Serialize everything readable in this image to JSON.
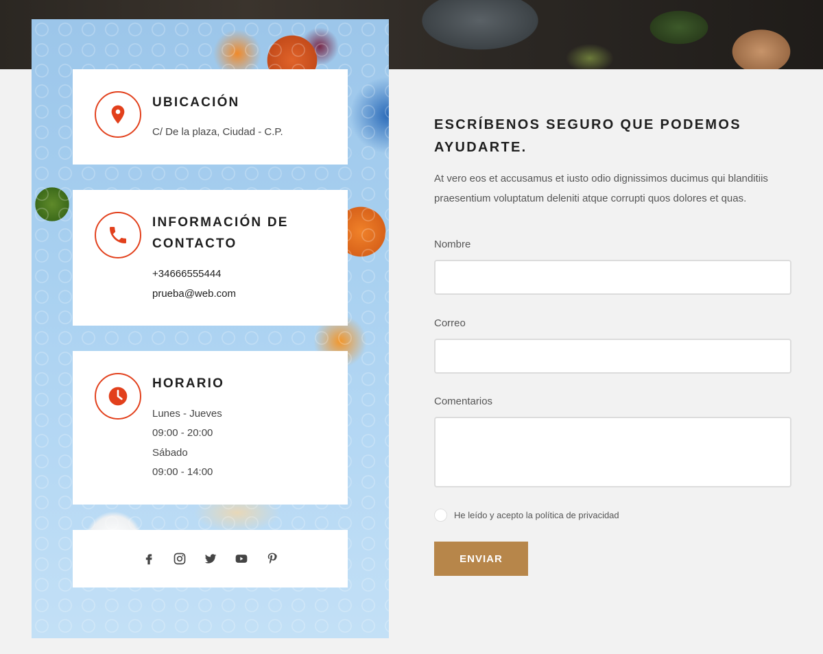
{
  "colors": {
    "accent": "#e2401c",
    "button": "#b7864a",
    "background": "#f2f2f2"
  },
  "contact": {
    "location": {
      "title": "UBICACIÓN",
      "address": "C/ De la plaza, Ciudad - C.P.",
      "icon": "map-pin-icon"
    },
    "info": {
      "title_line1": "INFORMACIÓN DE",
      "title_line2": "CONTACTO",
      "phone": "+34666555444",
      "email": "prueba@web.com",
      "icon": "phone-icon"
    },
    "hours": {
      "title": "HORARIO",
      "line1": "Lunes - Jueves",
      "line2": "09:00 - 20:00",
      "line3": "Sábado",
      "line4": "09:00 - 14:00",
      "icon": "clock-icon"
    },
    "social": [
      "facebook-icon",
      "instagram-icon",
      "twitter-icon",
      "youtube-icon",
      "pinterest-icon"
    ]
  },
  "form": {
    "title_line1": "ESCRÍBENOS SEGURO QUE PODEMOS",
    "title_line2": "AYUDARTE.",
    "description_line1": "At vero eos et accusamus et iusto odio dignissimos ducimus qui blanditiis",
    "description_line2": "praesentium voluptatum deleniti atque corrupti quos dolores et quas.",
    "name_label": "Nombre",
    "name_value": "",
    "email_label": "Correo",
    "email_value": "",
    "comments_label": "Comentarios",
    "comments_value": "",
    "consent_label": "He leído y acepto la política de privacidad",
    "submit_label": "ENVIAR"
  }
}
